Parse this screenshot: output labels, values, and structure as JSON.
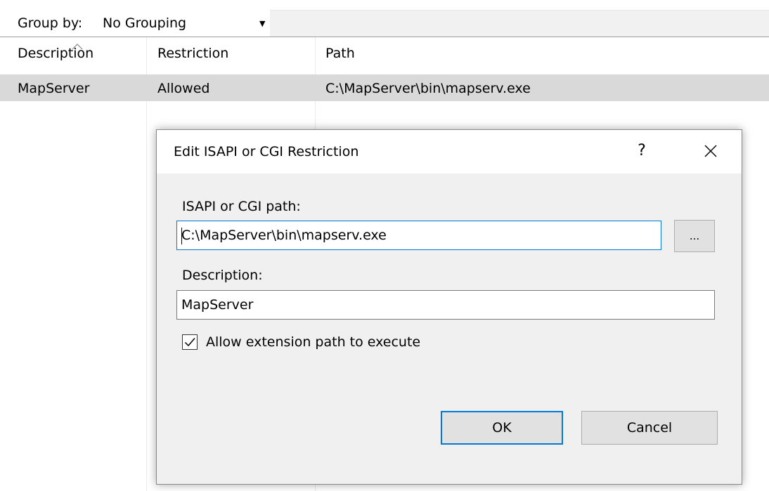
{
  "toolbar": {
    "group_by_label": "Group by:",
    "group_by_value": "No Grouping"
  },
  "table": {
    "columns": [
      "Description",
      "Restriction",
      "Path"
    ],
    "rows": [
      {
        "description": "MapServer",
        "restriction": "Allowed",
        "path": "C:\\MapServer\\bin\\mapserv.exe"
      }
    ]
  },
  "dialog": {
    "title": "Edit ISAPI or CGI Restriction",
    "help_label": "?",
    "path_label": "ISAPI or CGI path:",
    "path_value": "C:\\MapServer\\bin\\mapserv.exe",
    "browse_label": "...",
    "description_label": "Description:",
    "description_value": "MapServer",
    "allow_label": "Allow extension path to execute",
    "allow_checked": true,
    "ok_label": "OK",
    "cancel_label": "Cancel"
  },
  "colors": {
    "accent": "#0078d7",
    "selected_row": "#d9d9d9",
    "dialog_bg": "#f0f0f0"
  },
  "icons": [
    "chevron-up-icon",
    "dropdown-arrow-icon",
    "close-icon",
    "checkmark-icon"
  ]
}
